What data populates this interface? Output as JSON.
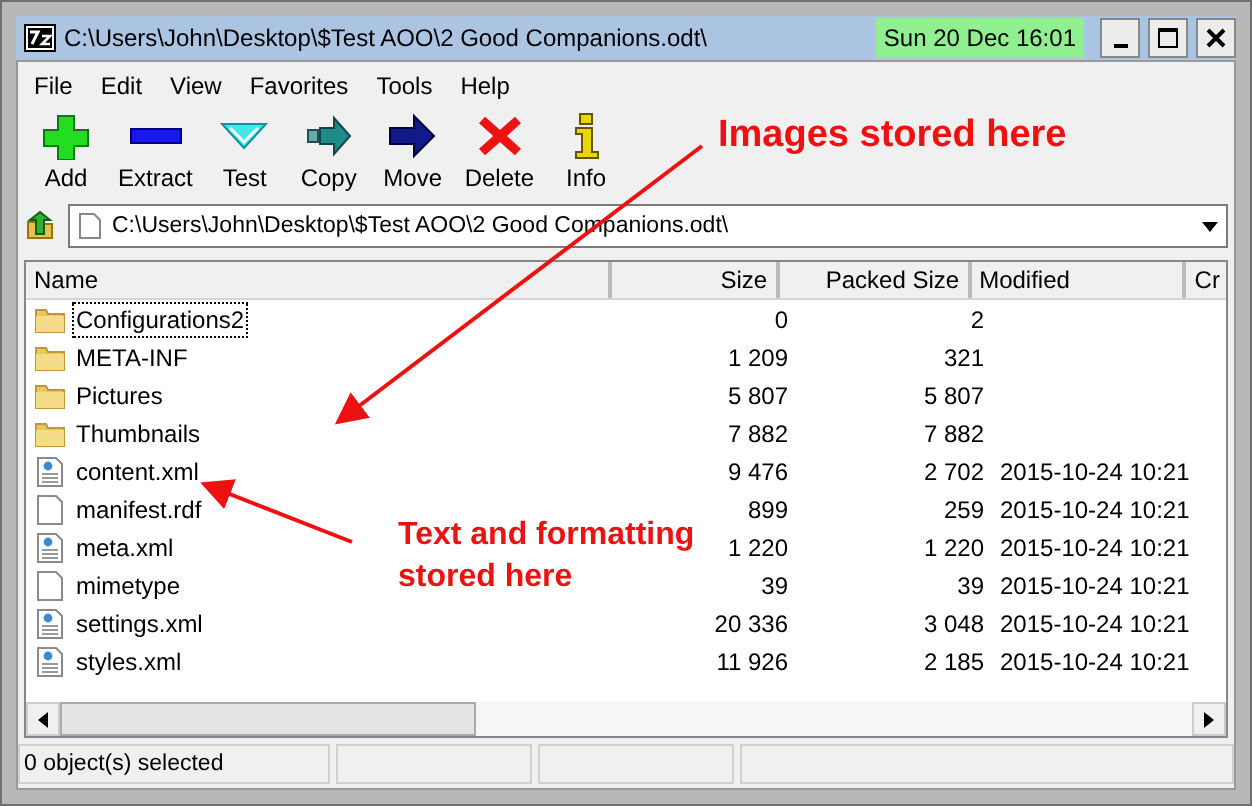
{
  "window": {
    "title": "C:\\Users\\John\\Desktop\\$Test AOO\\2 Good Companions.odt\\",
    "clock": "Sun  20  Dec 16:01"
  },
  "menu": [
    "File",
    "Edit",
    "View",
    "Favorites",
    "Tools",
    "Help"
  ],
  "toolbar": [
    {
      "label": "Add",
      "kind": "add"
    },
    {
      "label": "Extract",
      "kind": "extract"
    },
    {
      "label": "Test",
      "kind": "test"
    },
    {
      "label": "Copy",
      "kind": "copy"
    },
    {
      "label": "Move",
      "kind": "move"
    },
    {
      "label": "Delete",
      "kind": "delete"
    },
    {
      "label": "Info",
      "kind": "info"
    }
  ],
  "address": {
    "value": "C:\\Users\\John\\Desktop\\$Test AOO\\2 Good Companions.odt\\"
  },
  "table": {
    "columns": [
      "Name",
      "Size",
      "Packed Size",
      "Modified",
      "Cr"
    ],
    "rows": [
      {
        "kind": "folder",
        "name": "Configurations2",
        "size": "0",
        "packed": "2",
        "modified": "",
        "focused": true
      },
      {
        "kind": "folder",
        "name": "META-INF",
        "size": "1 209",
        "packed": "321",
        "modified": "",
        "focused": false
      },
      {
        "kind": "folder",
        "name": "Pictures",
        "size": "5 807",
        "packed": "5 807",
        "modified": "",
        "focused": false
      },
      {
        "kind": "folder",
        "name": "Thumbnails",
        "size": "7 882",
        "packed": "7 882",
        "modified": "",
        "focused": false
      },
      {
        "kind": "xml",
        "name": "content.xml",
        "size": "9 476",
        "packed": "2 702",
        "modified": "2015-10-24 10:21",
        "focused": false
      },
      {
        "kind": "file",
        "name": "manifest.rdf",
        "size": "899",
        "packed": "259",
        "modified": "2015-10-24 10:21",
        "focused": false
      },
      {
        "kind": "xml",
        "name": "meta.xml",
        "size": "1 220",
        "packed": "1 220",
        "modified": "2015-10-24 10:21",
        "focused": false
      },
      {
        "kind": "file",
        "name": "mimetype",
        "size": "39",
        "packed": "39",
        "modified": "2015-10-24 10:21",
        "focused": false
      },
      {
        "kind": "xml",
        "name": "settings.xml",
        "size": "20 336",
        "packed": "3 048",
        "modified": "2015-10-24 10:21",
        "focused": false
      },
      {
        "kind": "xml",
        "name": "styles.xml",
        "size": "11 926",
        "packed": "2 185",
        "modified": "2015-10-24 10:21",
        "focused": false
      }
    ]
  },
  "status_bar": [
    "0 object(s) selected"
  ],
  "annotations": [
    {
      "text": "Images stored here"
    },
    {
      "text": "Text and formatting stored here"
    }
  ]
}
